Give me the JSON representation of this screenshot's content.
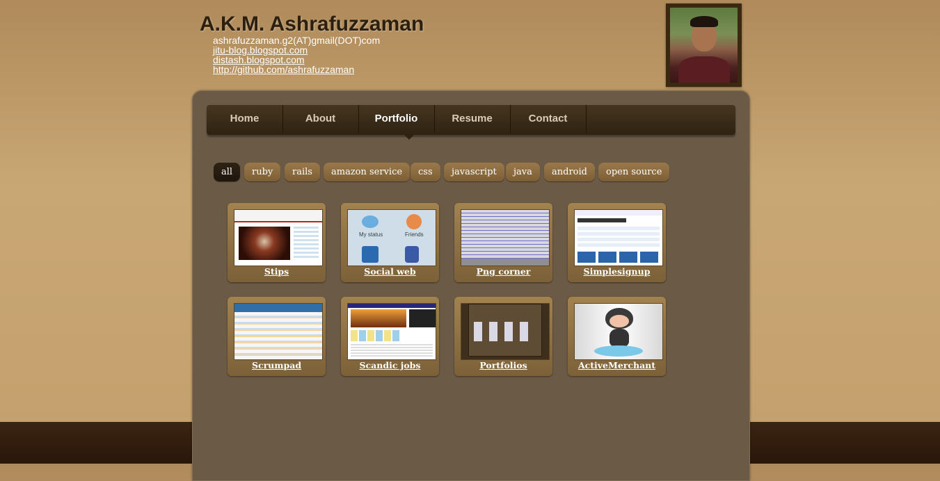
{
  "header": {
    "name": "A.K.M. Ashrafuzzaman",
    "email": "ashrafuzzaman.g2(AT)gmail(DOT)com",
    "links": [
      "jitu-blog.blogspot.com",
      "distash.blogspot.com",
      "http://github.com/ashrafuzzaman"
    ]
  },
  "nav": {
    "items": [
      "Home",
      "About",
      "Portfolio",
      "Resume",
      "Contact"
    ],
    "active": "Portfolio"
  },
  "filters": {
    "items": [
      "all",
      "ruby",
      "rails",
      "amazon service",
      "css",
      "javascript",
      "java",
      "android",
      "open source"
    ],
    "active": "all"
  },
  "portfolio": {
    "items": [
      {
        "label": "Stips"
      },
      {
        "label": "Social web",
        "thumb_text": [
          "My status",
          "Friends"
        ]
      },
      {
        "label": "Png corner"
      },
      {
        "label": "Simplesignup"
      },
      {
        "label": "Scrumpad"
      },
      {
        "label": "Scandic jobs"
      },
      {
        "label": "Portfolios"
      },
      {
        "label": "ActiveMerchant"
      }
    ]
  },
  "colors": {
    "background": "#c39f6c",
    "panel": "#6b5a46",
    "nav": "#2f2212",
    "card": "#8f7044"
  }
}
